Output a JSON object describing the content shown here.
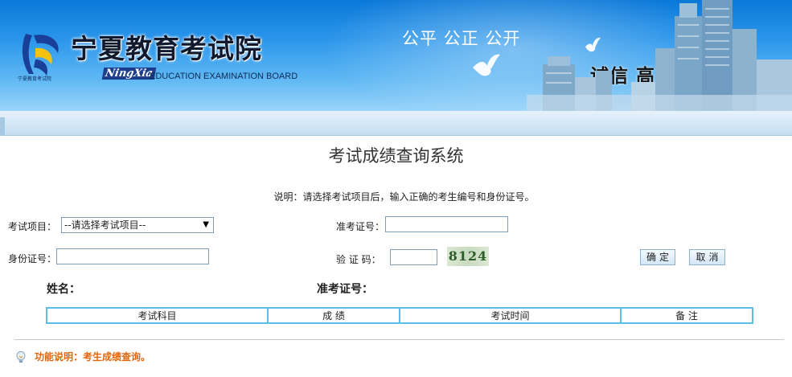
{
  "header": {
    "site_title": "宁夏教育考试院",
    "logo_caption": "宁夏教育考试院",
    "region_script": "NingXia",
    "board_name": "EDUCATION EXAMINATION BOARD",
    "slogan_top": "公平 公正 公开",
    "slogan_bottom": "诚信 高效 服务"
  },
  "page": {
    "title": "考试成绩查询系统",
    "instruction": "说明：请选择考试项目后，输入正确的考生编号和身份证号。"
  },
  "form": {
    "exam_item_label": "考试项目：",
    "exam_item_selected": "--请选择考试项目--",
    "ticket_label": "准考证号：",
    "ticket_value": "",
    "id_label": "身份证号：",
    "id_value": "",
    "verify_label": "验 证 码：",
    "verify_value": "",
    "captcha_text": "8124",
    "confirm_label": "确定",
    "cancel_label": "取消"
  },
  "result": {
    "name_label": "姓名：",
    "ticket_label": "准考证号：",
    "columns": [
      "考试科目",
      "成 绩",
      "考试时间",
      "备 注"
    ]
  },
  "footer": {
    "function_note": "功能说明：考生成绩查询。"
  },
  "colors": {
    "banner_blue": "#0a78d8",
    "table_border": "#58bfe8",
    "note_orange": "#e2660f"
  },
  "icons": {
    "logo": "ningxia-emblem-icon",
    "function": "lightbulb-icon"
  }
}
